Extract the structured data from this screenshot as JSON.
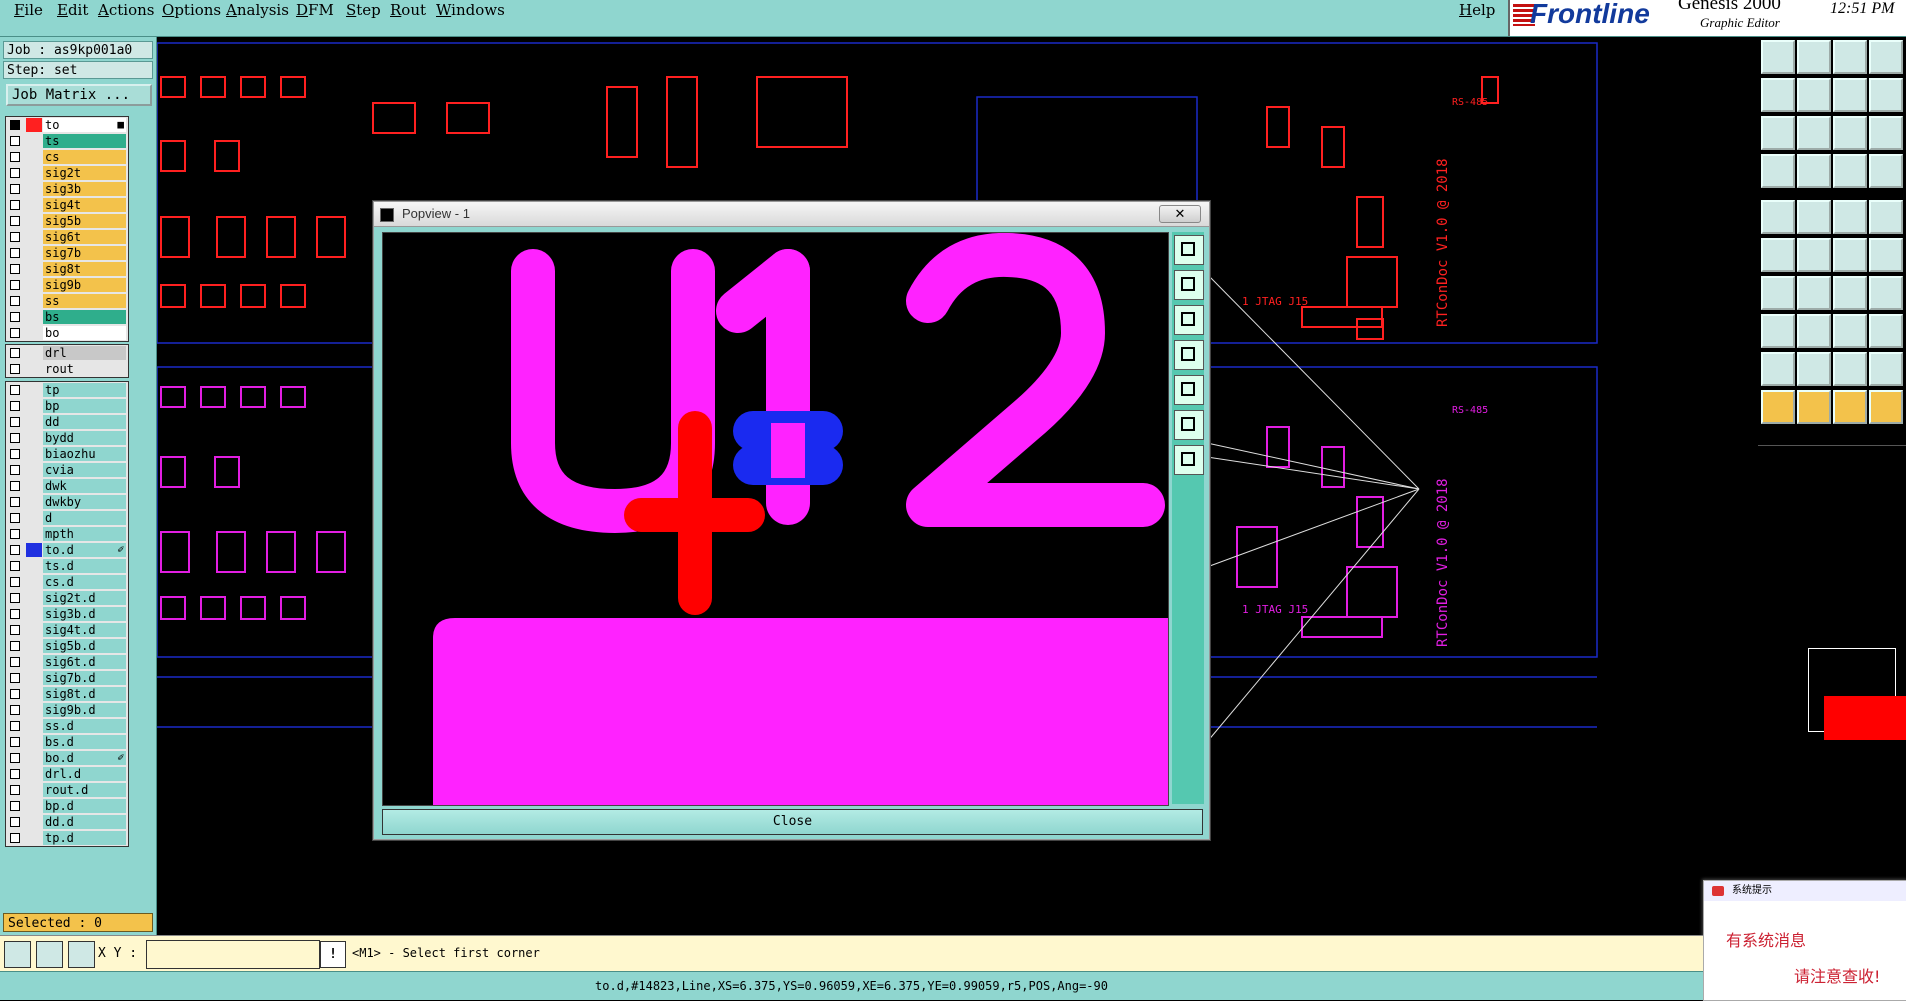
{
  "menubar": {
    "items": [
      "File",
      "Edit",
      "Actions",
      "Options",
      "Analysis",
      "DFM",
      "Step",
      "Rout",
      "Windows"
    ],
    "help": "Help",
    "brand_logo": "Frontline",
    "brand_title": "Genesis 2000",
    "brand_subtitle": "Graphic Editor",
    "clock": "12:51 PM"
  },
  "job": {
    "job_label": "Job : as9kp001a0",
    "step_label": "Step: set",
    "matrix_button": "Job Matrix ..."
  },
  "layers_board": [
    {
      "name": "to",
      "color": "#ff2020",
      "bg": "#ffffff",
      "checked": true,
      "mark": "■"
    },
    {
      "name": "ts",
      "color": "",
      "bg": "#2fae8c",
      "checked": false,
      "mark": ""
    },
    {
      "name": "cs",
      "color": "",
      "bg": "#f3c24b",
      "checked": false,
      "mark": ""
    },
    {
      "name": "sig2t",
      "color": "",
      "bg": "#f3c24b",
      "checked": false,
      "mark": ""
    },
    {
      "name": "sig3b",
      "color": "",
      "bg": "#f3c24b",
      "checked": false,
      "mark": ""
    },
    {
      "name": "sig4t",
      "color": "",
      "bg": "#f3c24b",
      "checked": false,
      "mark": ""
    },
    {
      "name": "sig5b",
      "color": "",
      "bg": "#f3c24b",
      "checked": false,
      "mark": ""
    },
    {
      "name": "sig6t",
      "color": "",
      "bg": "#f3c24b",
      "checked": false,
      "mark": ""
    },
    {
      "name": "sig7b",
      "color": "",
      "bg": "#f3c24b",
      "checked": false,
      "mark": ""
    },
    {
      "name": "sig8t",
      "color": "",
      "bg": "#f3c24b",
      "checked": false,
      "mark": ""
    },
    {
      "name": "sig9b",
      "color": "",
      "bg": "#f3c24b",
      "checked": false,
      "mark": ""
    },
    {
      "name": "ss",
      "color": "",
      "bg": "#f3c24b",
      "checked": false,
      "mark": ""
    },
    {
      "name": "bs",
      "color": "",
      "bg": "#2fae8c",
      "checked": false,
      "mark": ""
    },
    {
      "name": "bo",
      "color": "",
      "bg": "#ffffff",
      "checked": false,
      "mark": ""
    }
  ],
  "layers_drill": [
    {
      "name": "drl",
      "color": "",
      "bg": "#c8c8c8",
      "checked": false,
      "mark": ""
    },
    {
      "name": "rout",
      "color": "",
      "bg": "#e6e6e6",
      "checked": false,
      "mark": ""
    }
  ],
  "layers_misc": [
    {
      "name": "tp",
      "color": "",
      "bg": "#8fd6cf",
      "checked": false,
      "mark": ""
    },
    {
      "name": "bp",
      "color": "",
      "bg": "#8fd6cf",
      "checked": false,
      "mark": ""
    },
    {
      "name": "dd",
      "color": "",
      "bg": "#8fd6cf",
      "checked": false,
      "mark": ""
    },
    {
      "name": "bydd",
      "color": "",
      "bg": "#8fd6cf",
      "checked": false,
      "mark": ""
    },
    {
      "name": "biaozhu",
      "color": "",
      "bg": "#8fd6cf",
      "checked": false,
      "mark": ""
    },
    {
      "name": "cvia",
      "color": "",
      "bg": "#8fd6cf",
      "checked": false,
      "mark": ""
    },
    {
      "name": "dwk",
      "color": "",
      "bg": "#8fd6cf",
      "checked": false,
      "mark": ""
    },
    {
      "name": "dwkby",
      "color": "",
      "bg": "#8fd6cf",
      "checked": false,
      "mark": ""
    },
    {
      "name": "d",
      "color": "",
      "bg": "#8fd6cf",
      "checked": false,
      "mark": ""
    },
    {
      "name": "mpth",
      "color": "",
      "bg": "#8fd6cf",
      "checked": false,
      "mark": ""
    },
    {
      "name": "to.d",
      "color": "#2030e0",
      "bg": "#8fd6cf",
      "checked": false,
      "mark": "✐"
    },
    {
      "name": "ts.d",
      "color": "",
      "bg": "#8fd6cf",
      "checked": false,
      "mark": ""
    },
    {
      "name": "cs.d",
      "color": "",
      "bg": "#8fd6cf",
      "checked": false,
      "mark": ""
    },
    {
      "name": "sig2t.d",
      "color": "",
      "bg": "#8fd6cf",
      "checked": false,
      "mark": ""
    },
    {
      "name": "sig3b.d",
      "color": "",
      "bg": "#8fd6cf",
      "checked": false,
      "mark": ""
    },
    {
      "name": "sig4t.d",
      "color": "",
      "bg": "#8fd6cf",
      "checked": false,
      "mark": ""
    },
    {
      "name": "sig5b.d",
      "color": "",
      "bg": "#8fd6cf",
      "checked": false,
      "mark": ""
    },
    {
      "name": "sig6t.d",
      "color": "",
      "bg": "#8fd6cf",
      "checked": false,
      "mark": ""
    },
    {
      "name": "sig7b.d",
      "color": "",
      "bg": "#8fd6cf",
      "checked": false,
      "mark": ""
    },
    {
      "name": "sig8t.d",
      "color": "",
      "bg": "#8fd6cf",
      "checked": false,
      "mark": ""
    },
    {
      "name": "sig9b.d",
      "color": "",
      "bg": "#8fd6cf",
      "checked": false,
      "mark": ""
    },
    {
      "name": "ss.d",
      "color": "",
      "bg": "#8fd6cf",
      "checked": false,
      "mark": ""
    },
    {
      "name": "bs.d",
      "color": "",
      "bg": "#8fd6cf",
      "checked": false,
      "mark": ""
    },
    {
      "name": "bo.d",
      "color": "",
      "bg": "#8fd6cf",
      "checked": false,
      "mark": "✐"
    },
    {
      "name": "drl.d",
      "color": "",
      "bg": "#8fd6cf",
      "checked": false,
      "mark": ""
    },
    {
      "name": "rout.d",
      "color": "",
      "bg": "#8fd6cf",
      "checked": false,
      "mark": ""
    },
    {
      "name": "bp.d",
      "color": "",
      "bg": "#8fd6cf",
      "checked": false,
      "mark": ""
    },
    {
      "name": "dd.d",
      "color": "",
      "bg": "#8fd6cf",
      "checked": false,
      "mark": ""
    },
    {
      "name": "tp.d",
      "color": "",
      "bg": "#8fd6cf",
      "checked": false,
      "mark": ""
    }
  ],
  "selected": "Selected : 0",
  "popview": {
    "title": "Popview - 1",
    "close_x": "✕",
    "close_button": "Close",
    "designator": [
      "U",
      "1",
      "2"
    ]
  },
  "canvas_labels": {
    "board_text": "RTConDoc V1.0 @ 2018",
    "jtag": "1 JTAG J15",
    "rs485": "RS-485"
  },
  "notice": {
    "header": "系统提示",
    "line1": "有系统消息",
    "line2": "请注意查收!"
  },
  "bottombar": {
    "xy_label": "X Y :",
    "xy_value": "",
    "prompt_icon": "!",
    "prompt": "<M1> - Select first corner"
  },
  "status": "to.d,#14823,Line,XS=6.375,YS=0.96059,XE=6.375,YE=0.99059,r5,POS,Ang=-90",
  "colors": {
    "ui_teal": "#8fd6cf",
    "layer_top": "#ff2020",
    "layer_sel": "#2030e0",
    "magenta": "#ff22ff",
    "accent_yellow": "#f3c24b"
  }
}
